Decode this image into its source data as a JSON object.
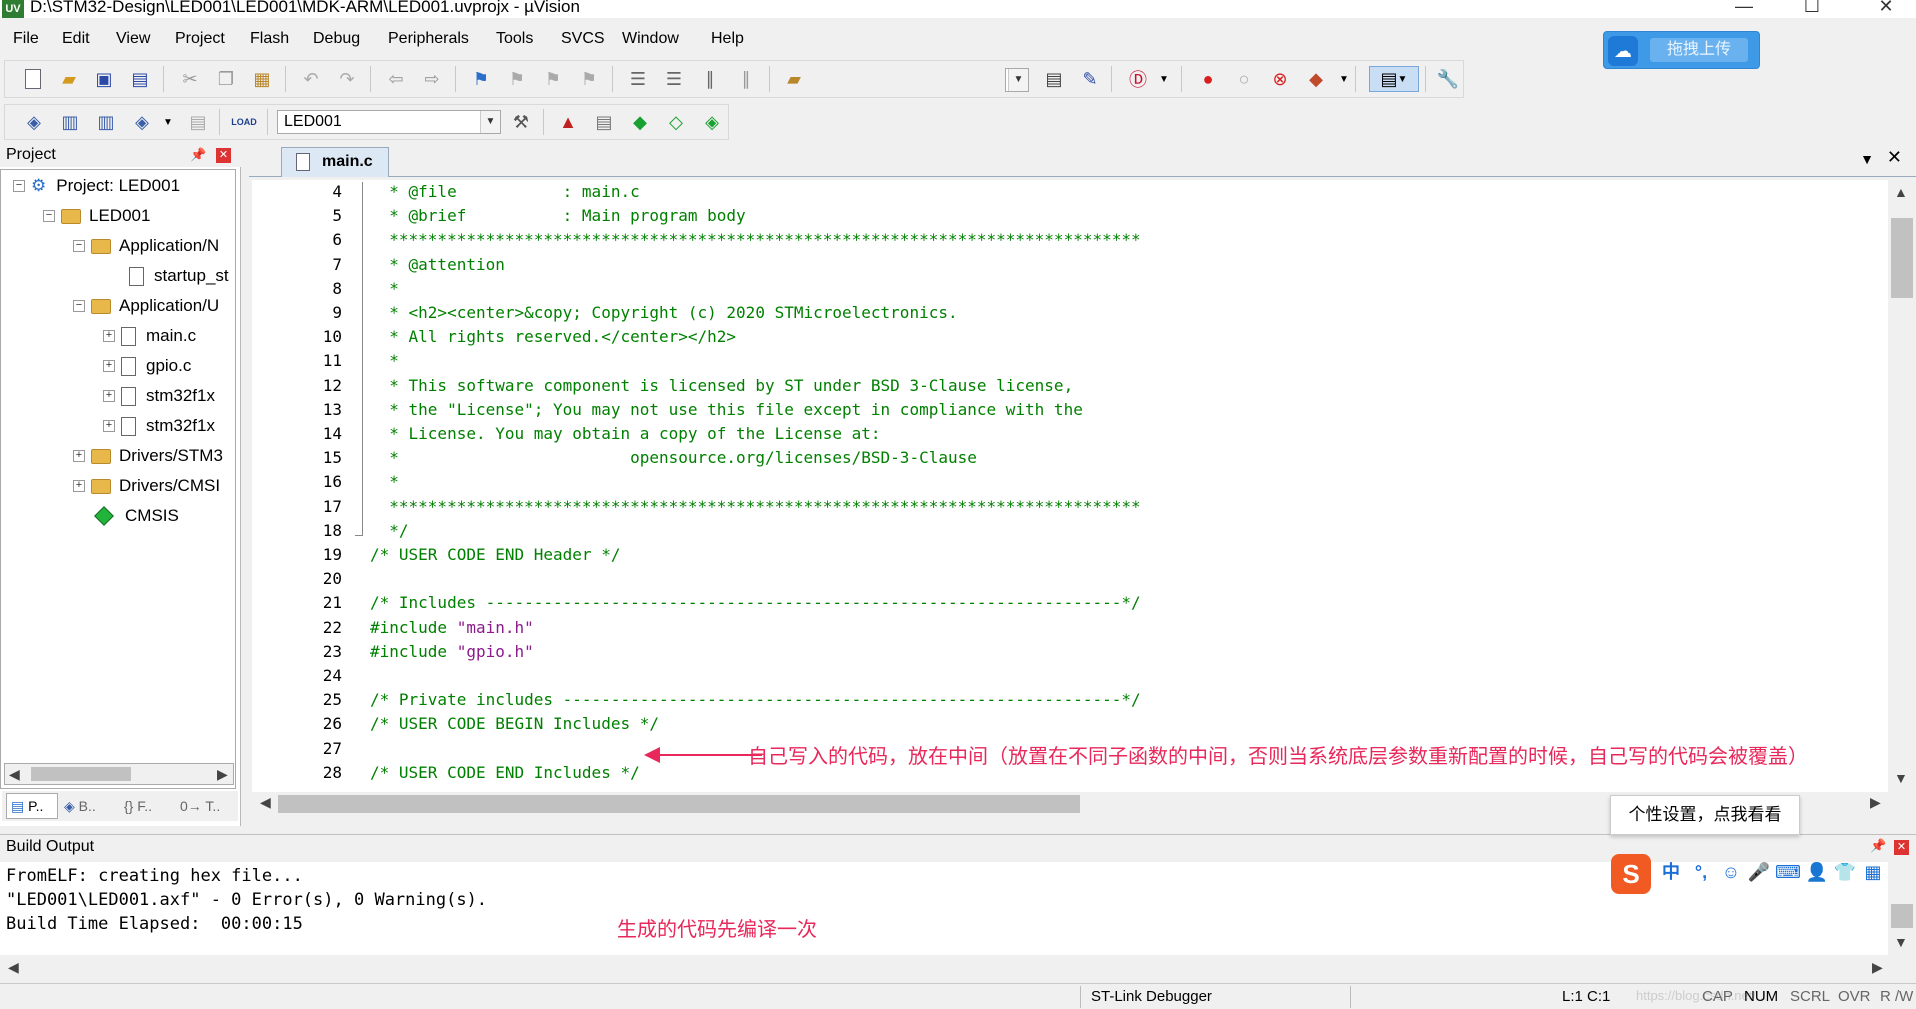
{
  "window": {
    "title": "D:\\STM32-Design\\LED001\\LED001\\MDK-ARM\\LED001.uvprojx - µVision",
    "minimize_icon": "minimize-icon",
    "maximize_icon": "maximize-icon",
    "close_icon": "close-icon"
  },
  "menu": [
    "File",
    "Edit",
    "View",
    "Project",
    "Flash",
    "Debug",
    "Peripherals",
    "Tools",
    "SVCS",
    "Window",
    "Help"
  ],
  "upload_button": {
    "label": "拖拽上传"
  },
  "toolbar2": {
    "target": "LED001",
    "load_label": "LOAD"
  },
  "project_panel": {
    "title": "Project",
    "tree": [
      {
        "label": "Project: LED001"
      },
      {
        "label": "LED001"
      },
      {
        "label": "Application/N"
      },
      {
        "label": "startup_st"
      },
      {
        "label": "Application/U"
      },
      {
        "label": "main.c"
      },
      {
        "label": "gpio.c"
      },
      {
        "label": "stm32f1x"
      },
      {
        "label": "stm32f1x"
      },
      {
        "label": "Drivers/STM3"
      },
      {
        "label": "Drivers/CMSI"
      },
      {
        "label": "CMSIS"
      }
    ],
    "tabs": [
      "P..",
      "B..",
      "{} F..",
      "0→ T.."
    ]
  },
  "editor": {
    "tab": "main.c",
    "lines": [
      {
        "n": "4",
        "text": "  * @file           : main.c"
      },
      {
        "n": "5",
        "text": "  * @brief          : Main program body"
      },
      {
        "n": "6",
        "text": "  ******************************************************************************"
      },
      {
        "n": "7",
        "text": "  * @attention"
      },
      {
        "n": "8",
        "text": "  *"
      },
      {
        "n": "9",
        "text": "  * <h2><center>&copy; Copyright (c) 2020 STMicroelectronics."
      },
      {
        "n": "10",
        "text": "  * All rights reserved.</center></h2>"
      },
      {
        "n": "11",
        "text": "  *"
      },
      {
        "n": "12",
        "text": "  * This software component is licensed by ST under BSD 3-Clause license,"
      },
      {
        "n": "13",
        "text": "  * the \"License\"; You may not use this file except in compliance with the"
      },
      {
        "n": "14",
        "text": "  * License. You may obtain a copy of the License at:"
      },
      {
        "n": "15",
        "text": "  *                        opensource.org/licenses/BSD-3-Clause"
      },
      {
        "n": "16",
        "text": "  *"
      },
      {
        "n": "17",
        "text": "  ******************************************************************************"
      },
      {
        "n": "18",
        "text": "  */"
      },
      {
        "n": "19",
        "text": "/* USER CODE END Header */"
      },
      {
        "n": "20",
        "text": ""
      },
      {
        "n": "21",
        "text": "/* Includes ------------------------------------------------------------------*/"
      },
      {
        "n": "22",
        "text": "#include",
        "str": " \"main.h\""
      },
      {
        "n": "23",
        "text": "#include",
        "str": " \"gpio.h\""
      },
      {
        "n": "24",
        "text": ""
      },
      {
        "n": "25",
        "text": "/* Private includes ----------------------------------------------------------*/"
      },
      {
        "n": "26",
        "text": "/* USER CODE BEGIN Includes */"
      },
      {
        "n": "27",
        "text": ""
      },
      {
        "n": "28",
        "text": "/* USER CODE END Includes */"
      }
    ],
    "annotation": "自己写入的代码，放在中间（放置在不同子函数的中间，否则当系统底层参数重新配置的时候，自己写的代码会被覆盖）"
  },
  "build_output": {
    "title": "Build Output",
    "lines": [
      "FromELF: creating hex file...",
      "\"LED001\\LED001.axf\" - 0 Error(s), 0 Warning(s).",
      "Build Time Elapsed:  00:00:15"
    ],
    "annotation": "生成的代码先编译一次"
  },
  "ime": {
    "tooltip": "个性设置，点我看看",
    "mode": "中"
  },
  "status": {
    "debugger": "ST-Link Debugger",
    "cursor": "L:1 C:1",
    "watermark": "https://blog.csdn.net/...",
    "caps": "CAP",
    "num": "NUM",
    "scrl": "SCRL",
    "ovr": "OVR",
    "rw": "R /W"
  }
}
